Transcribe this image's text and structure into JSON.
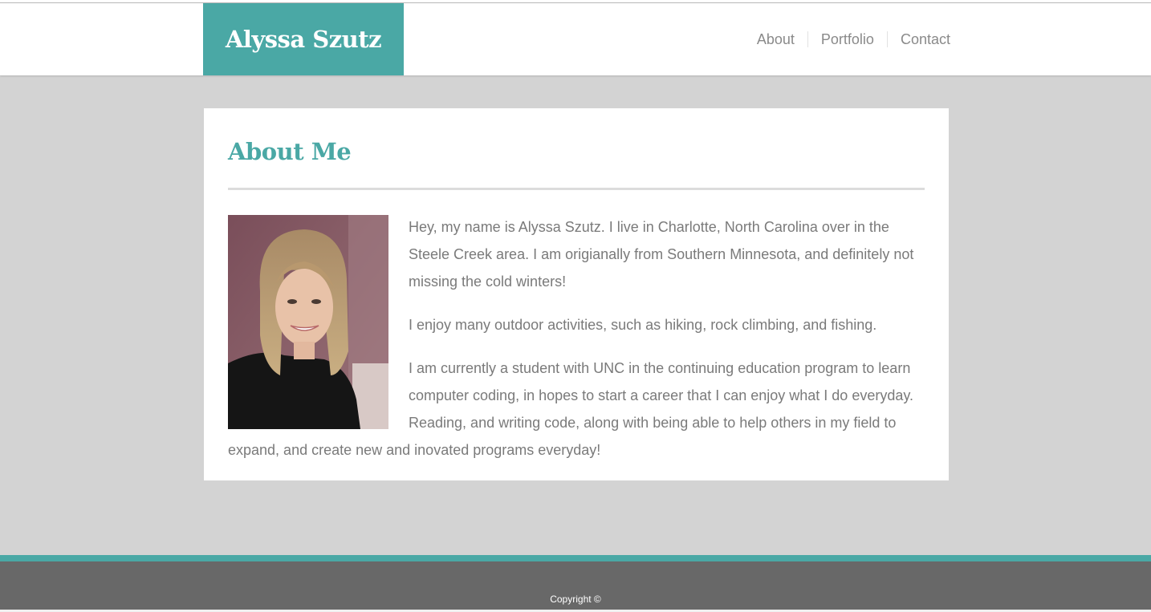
{
  "header": {
    "brand": "Alyssa Szutz",
    "nav": [
      "About",
      "Portfolio",
      "Contact"
    ]
  },
  "main": {
    "title": "About Me",
    "photo_alt": "photo of Alyssa Szutz",
    "paragraphs": [
      "Hey, my name is Alyssa Szutz. I live in Charlotte, North Carolina over in the Steele Creek area. I am origianally from Southern Minnesota, and definitely not missing the cold winters!",
      "I enjoy many outdoor activities, such as hiking, rock climbing, and fishing.",
      "I am currently a student with UNC in the continuing education program to learn computer coding, in hopes to start a career that I can enjoy what I do everyday. Reading, and writing code, along with being able to help others in my field to expand, and create new and inovated programs everyday!"
    ]
  },
  "footer": {
    "copyright": "Copyright ©"
  },
  "colors": {
    "accent": "#4aa8a5",
    "page_background": "#d3d3d3",
    "footer_background": "#686868"
  }
}
